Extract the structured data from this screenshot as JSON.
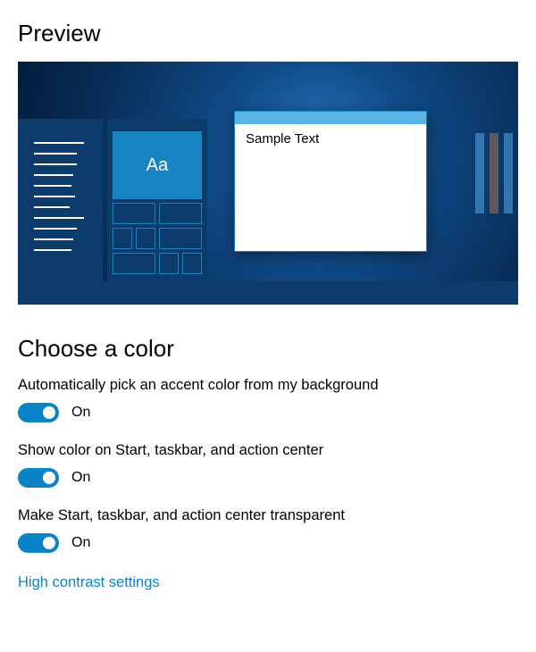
{
  "preview": {
    "heading": "Preview",
    "tile_text": "Aa",
    "window_text": "Sample Text"
  },
  "choose": {
    "heading": "Choose a color",
    "options": [
      {
        "label": "Automatically pick an accent color from my background",
        "state": "On"
      },
      {
        "label": "Show color on Start, taskbar, and action center",
        "state": "On"
      },
      {
        "label": "Make Start, taskbar, and action center transparent",
        "state": "On"
      }
    ],
    "link": "High contrast settings"
  },
  "colors": {
    "accent": "#0a84c6"
  }
}
